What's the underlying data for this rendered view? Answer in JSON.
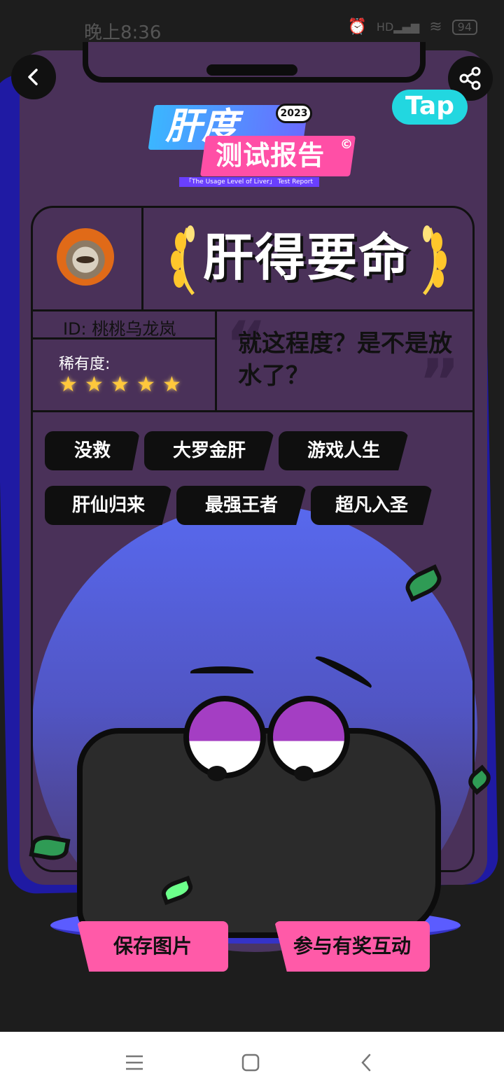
{
  "status_bar": {
    "time": "晚上8:36",
    "battery": "94",
    "network": "HD"
  },
  "header": {
    "brand": "Tap"
  },
  "title": {
    "main": "肝度",
    "year": "2023",
    "sub": "测试报告",
    "copyright": "©",
    "english": "「The Usage Level of Liver」 Test Report"
  },
  "profile": {
    "rank_title": "肝得要命",
    "user_id": "ID: 桃桃乌龙岚",
    "rarity_label": "稀有度:",
    "stars": [
      "★",
      "★",
      "★",
      "★",
      "★"
    ],
    "comment": "就这程度？是不是放水了？"
  },
  "tags": [
    "没救",
    "大罗金肝",
    "游戏人生",
    "肝仙归来",
    "最强王者",
    "超凡入圣"
  ],
  "actions": {
    "save": "保存图片",
    "participate": "参与有奖互动"
  },
  "colors": {
    "card": "#4a3159",
    "shadow_card": "#1f1aa3",
    "accent_pink": "#ff5aa8",
    "tap_cyan": "#22d7e0",
    "star": "#ffc83c"
  },
  "icons": {
    "back": "chevron-left-icon",
    "share": "share-icon",
    "nav_menu": "menu-icon",
    "nav_home": "square-icon",
    "nav_back": "chevron-left-icon"
  }
}
